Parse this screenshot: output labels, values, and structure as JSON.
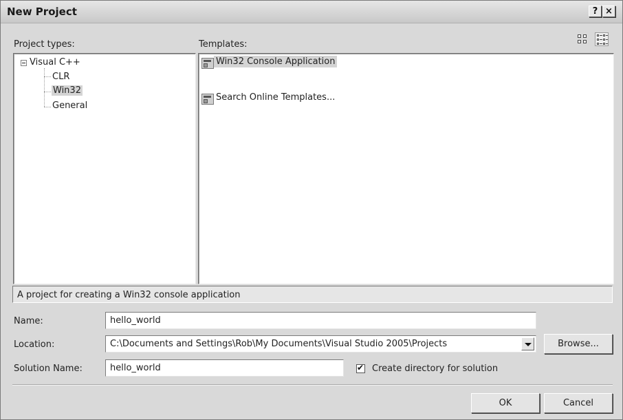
{
  "window": {
    "title": "New Project",
    "help_glyph": "?",
    "close_glyph": "×"
  },
  "project_types": {
    "label": "Project types:",
    "tree": {
      "root": "Visual C++",
      "children": [
        "CLR",
        "Win32",
        "General"
      ],
      "selected": "Win32"
    }
  },
  "templates": {
    "label": "Templates:",
    "items": [
      {
        "label": "Win32 Console Application",
        "icon": "win32-console-app-icon",
        "selected": true
      },
      {
        "label": "Search Online Templates...",
        "icon": "search-online-templates-icon",
        "selected": false
      }
    ],
    "view_buttons": [
      "large-icons-view-icon",
      "small-icons-view-icon"
    ]
  },
  "description": "A project for creating a Win32 console application",
  "form": {
    "name_label": "Name:",
    "name_value": "hello_world",
    "location_label": "Location:",
    "location_value": "C:\\Documents and Settings\\Rob\\My Documents\\Visual Studio 2005\\Projects",
    "browse_label": "Browse...",
    "solution_label": "Solution Name:",
    "solution_value": "hello_world",
    "create_dir_label": "Create directory for solution",
    "create_dir_checked": true
  },
  "buttons": {
    "ok": "OK",
    "cancel": "Cancel"
  }
}
